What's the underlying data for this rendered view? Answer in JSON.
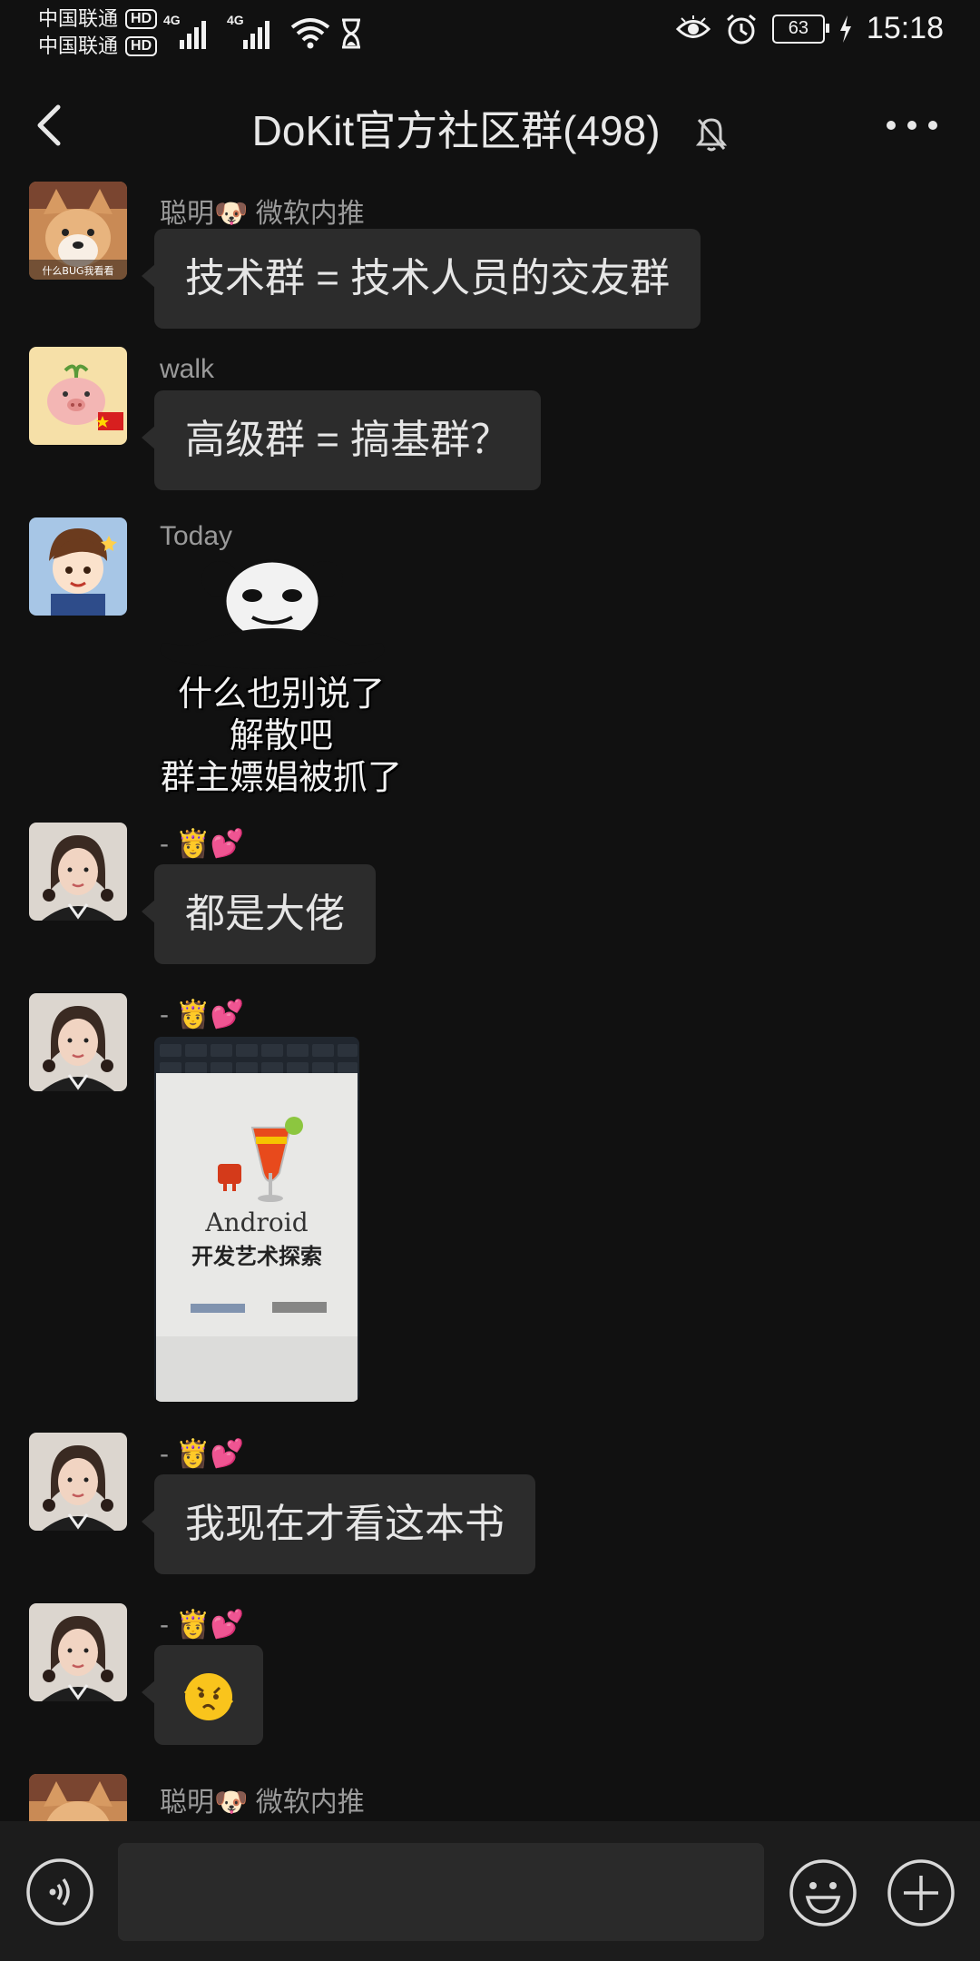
{
  "status_bar": {
    "carrier1": "中国联通",
    "carrier2": "中国联通",
    "hd": "HD",
    "net": "4G",
    "battery": "63",
    "time": "15:18"
  },
  "header": {
    "title": "DoKit官方社区群(498)"
  },
  "messages": [
    {
      "sender": "聪明🐶 微软内推",
      "text": "技术群 = 技术人员的交友群",
      "avatar": "shiba-dog-avatar"
    },
    {
      "sender": "walk",
      "text": "高级群 = 搞基群？",
      "avatar": "pig-avatar"
    },
    {
      "sender": "Today",
      "sticker_lines": [
        "什么也别说了",
        "解散吧",
        "群主嫖娼被抓了"
      ],
      "avatar": "cartoon-boy-avatar"
    },
    {
      "sender": "- 👸💕",
      "text": "都是大佬",
      "avatar": "woman-avatar"
    },
    {
      "sender": "- 👸💕",
      "photo_title": "Android",
      "photo_subtitle": "开发艺术探索",
      "avatar": "woman-avatar"
    },
    {
      "sender": "- 👸💕",
      "text": "我现在才看这本书",
      "avatar": "woman-avatar"
    },
    {
      "sender": "- 👸💕",
      "text": "🫨",
      "avatar": "woman-avatar"
    },
    {
      "sender": "聪明🐶 微软内推",
      "avatar": "shiba-dog-avatar"
    }
  ],
  "input": {
    "placeholder": ""
  },
  "colors": {
    "background": "#111111",
    "bubble": "#2c2c2c",
    "input_bar": "#1c1c1c"
  }
}
